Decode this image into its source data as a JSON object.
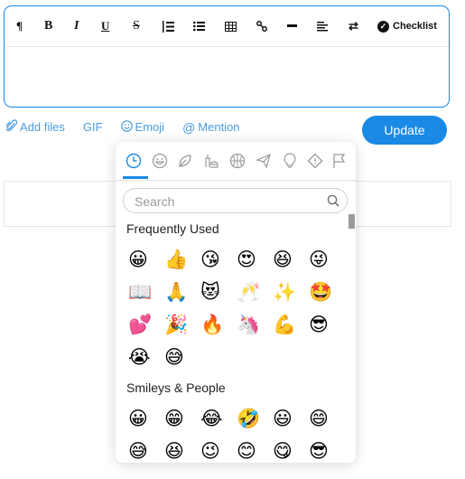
{
  "toolbar": {
    "items": [
      {
        "name": "paragraph",
        "glyph": "¶"
      },
      {
        "name": "bold",
        "glyph": "B"
      },
      {
        "name": "italic",
        "glyph": "I"
      },
      {
        "name": "underline",
        "glyph": "U"
      },
      {
        "name": "strikethrough",
        "glyph": "S"
      },
      {
        "name": "ordered-list",
        "glyph": ""
      },
      {
        "name": "bullet-list",
        "glyph": ""
      },
      {
        "name": "table",
        "glyph": ""
      },
      {
        "name": "link",
        "glyph": ""
      },
      {
        "name": "horizontal-rule",
        "glyph": ""
      },
      {
        "name": "align",
        "glyph": ""
      },
      {
        "name": "text-direction",
        "glyph": "⇄"
      }
    ],
    "checklist_label": "Checklist"
  },
  "actions": {
    "add_files": "Add files",
    "gif": "GIF",
    "emoji": "Emoji",
    "mention": "Mention",
    "update": "Update"
  },
  "picker": {
    "categories": [
      "recent",
      "smileys",
      "nature",
      "food",
      "activity",
      "travel",
      "objects",
      "symbols",
      "flags"
    ],
    "active_category": "recent",
    "search_placeholder": "Search",
    "sections": [
      {
        "title": "Frequently Used",
        "emojis": [
          "😀",
          "👍",
          "😘",
          "😍",
          "😆",
          "😜",
          "📖",
          "🙏",
          "😻",
          "🥂",
          "✨",
          "🤩",
          "💕",
          "🎉",
          "🔥",
          "🦄",
          "💪",
          "😎",
          "😭",
          "😅"
        ]
      },
      {
        "title": "Smileys & People",
        "emojis": [
          "😀",
          "😁",
          "😂",
          "🤣",
          "😃",
          "😄",
          "😅",
          "😆",
          "😉",
          "😊",
          "😋",
          "😎"
        ]
      }
    ]
  }
}
